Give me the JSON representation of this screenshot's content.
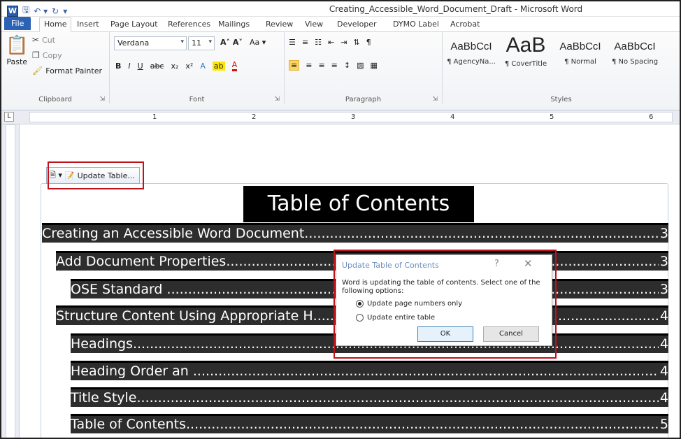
{
  "window": {
    "title": "Creating_Accessible_Word_Document_Draft  -  Microsoft Word"
  },
  "qat": {
    "logo": "W",
    "save_icon": "save-icon",
    "undo_icon": "undo-icon",
    "redo_icon": "redo-icon"
  },
  "tabs": [
    "File",
    "Home",
    "Insert",
    "Page Layout",
    "References",
    "Mailings",
    "Review",
    "View",
    "Developer",
    "DYMO Label",
    "Acrobat"
  ],
  "ribbon": {
    "clipboard": {
      "label": "Clipboard",
      "paste": "Paste",
      "cut": "Cut",
      "copy": "Copy",
      "format_painter": "Format Painter"
    },
    "font": {
      "label": "Font",
      "font_name": "Verdana",
      "font_size": "11"
    },
    "paragraph": {
      "label": "Paragraph"
    },
    "styles": {
      "label": "Styles",
      "items": [
        {
          "sample": "AaBbCcI",
          "name": "¶ AgencyNa..."
        },
        {
          "sample": "AaB",
          "name": "¶ CoverTitle"
        },
        {
          "sample": "AaBbCcI",
          "name": "¶ Normal"
        },
        {
          "sample": "AaBbCcI",
          "name": "¶ No Spacing"
        }
      ]
    }
  },
  "ruler": {
    "corner": "L",
    "numbers": [
      "1",
      "2",
      "3",
      "4",
      "5",
      "6"
    ]
  },
  "document": {
    "update_table_button": "Update Table...",
    "toc_heading": "Table of Contents",
    "toc_entries": [
      {
        "text": "Creating an Accessible Word Document",
        "page": "3"
      },
      {
        "text": "Add Document Properties",
        "page": "3"
      },
      {
        "text": "OSE Standard ",
        "page": "3"
      },
      {
        "text": "Structure Content Using Appropriate H",
        "page": "4"
      },
      {
        "text": "Headings",
        "page": "4"
      },
      {
        "text": "Heading Order an ",
        "page": "4"
      },
      {
        "text": "Title Style",
        "page": "4"
      },
      {
        "text": "Table of Contents",
        "page": "5"
      }
    ]
  },
  "dialog": {
    "title": "Update Table of Contents",
    "help": "?",
    "close": "✕",
    "message": "Word is updating the table of contents.  Select one of the following options:",
    "options": [
      {
        "label": "Update page numbers only",
        "checked": true
      },
      {
        "label": "Update entire table",
        "checked": false
      }
    ],
    "ok": "OK",
    "cancel": "Cancel"
  },
  "colors": {
    "callout": "#c0121b",
    "toc_row_bg": "#2d2d2d",
    "file_tab": "#2c62b5"
  }
}
